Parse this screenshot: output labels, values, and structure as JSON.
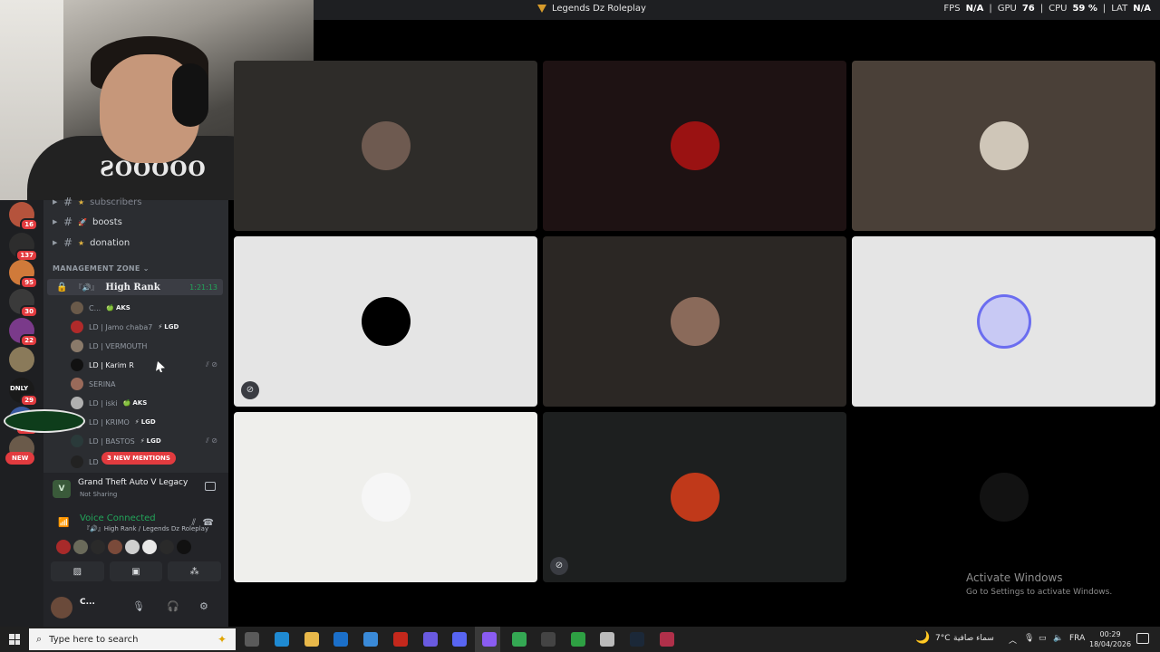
{
  "window": {
    "title": "Legends Dz Roleplay",
    "stats": {
      "fps_label": "FPS",
      "fps": "N/A",
      "gpu_label": "GPU",
      "gpu": "76",
      "cpu_label": "CPU",
      "cpu": "59 %",
      "lat_label": "LAT",
      "lat": "N/A"
    }
  },
  "servers": [
    {
      "badge": "16",
      "color": "#b5533c"
    },
    {
      "badge": "137",
      "color": "#2d2d2d"
    },
    {
      "badge": "95",
      "color": "#d07a3a"
    },
    {
      "badge": "30",
      "color": "#3a3a3a"
    },
    {
      "badge": "22",
      "color": "#7a3a8a"
    },
    {
      "badge": "",
      "color": "#8a7a5a"
    },
    {
      "badge": "29",
      "color": "#1a1a1a"
    },
    {
      "badge": "131",
      "color": "#3a5aa0"
    },
    {
      "badge": "",
      "color": "#6a5a4a"
    }
  ],
  "server_logo_text": "DNLY",
  "new_pill": "NEW",
  "channels": [
    {
      "name": "subscribers",
      "star": true
    },
    {
      "name": "boosts",
      "icon": "rocket"
    },
    {
      "name": "donation",
      "star": true
    }
  ],
  "category": "MANAGEMENT ZONE",
  "voice_channel": {
    "name": "High Rank",
    "prefix": "『🔊』",
    "timer": "1:21:13"
  },
  "members": [
    {
      "name": "C...",
      "tag": "AKS",
      "tag_icon": "🍏",
      "online": false,
      "color": "#6a5a4a"
    },
    {
      "name": "LD | Jamo chaba7",
      "tag": "LGD",
      "tag_icon": "⚡",
      "online": false,
      "color": "#b02a2a"
    },
    {
      "name": "LD | VERMOUTH",
      "tag": "",
      "online": false,
      "color": "#8a7a6a"
    },
    {
      "name": "LD | Karim R",
      "tag": "",
      "online": true,
      "color": "#111111"
    },
    {
      "name": "SERINA",
      "tag": "",
      "online": false,
      "color": "#9a6a5a"
    },
    {
      "name": "LD | iski",
      "tag": "AKS",
      "tag_icon": "🍏",
      "online": false,
      "color": "#b0b0b0"
    },
    {
      "name": "LD | KRIMO",
      "tag": "LGD",
      "tag_icon": "⚡",
      "online": false,
      "color": "#d8d8d8"
    },
    {
      "name": "LD | BASTOS",
      "tag": "LGD",
      "tag_icon": "⚡",
      "online": false,
      "color": "#2a3a3a"
    },
    {
      "name": "LD",
      "tag": "",
      "online": false,
      "color": "#222222"
    }
  ],
  "mentions_pill": "3 NEW MENTIONS",
  "activity": {
    "game": "Grand Theft Auto V Legacy",
    "status": "Not Sharing"
  },
  "voice": {
    "status": "Voice Connected",
    "channel": "『🔊』High Rank / Legends Dz Roleplay"
  },
  "voice_avatars": [
    "#a82a2a",
    "#6a6a5a",
    "#2a2a2a",
    "#7a4a3a",
    "#cfcfcf",
    "#e8e8e8",
    "#2a2a2a",
    "#111111"
  ],
  "user": {
    "name": "C..."
  },
  "tiles": [
    {
      "bg": "#2e2c29",
      "pic": "#6e5a50",
      "mute": false
    },
    {
      "bg": "#1e1213",
      "pic": "#9a1212",
      "mute": false
    },
    {
      "bg": "#4a4038",
      "pic": "#cfc6b8",
      "mute": false
    },
    {
      "bg": "#e5e5e5",
      "pic": "#000000",
      "mute": true
    },
    {
      "bg": "#2b2724",
      "pic": "#8a6a5a",
      "mute": false
    },
    {
      "bg": "#e5e5e5",
      "pic": "#c8c9f4",
      "mute": false
    },
    {
      "bg": "#efefec",
      "pic": "#f6f6f6",
      "mute": false
    },
    {
      "bg": "#1d1f1f",
      "pic": "#c0391a",
      "mute": true
    },
    {
      "bg": "#000000",
      "pic": "#121212",
      "mute": false
    }
  ],
  "activate": {
    "line1": "Activate Windows",
    "line2": "Go to Settings to activate Windows."
  },
  "taskbar": {
    "search_placeholder": "Type here to search",
    "weather": "7°C",
    "weather_text": "سماء صافية",
    "lang": "FRA",
    "time": "00:29",
    "date": "18/04/2026"
  }
}
